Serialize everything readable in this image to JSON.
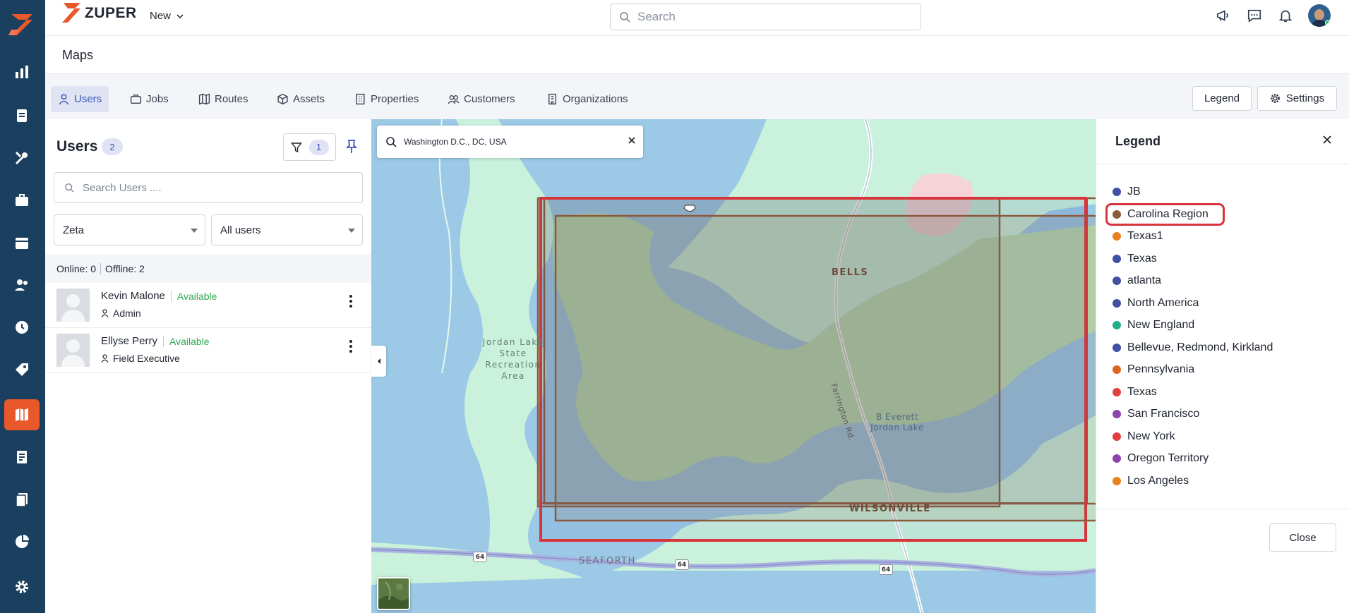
{
  "app": {
    "brand": "ZUPER",
    "new_menu": "New",
    "search_placeholder": "Search"
  },
  "page": {
    "title": "Maps"
  },
  "tabs": [
    {
      "label": "Users",
      "icon": "user-icon",
      "active": true
    },
    {
      "label": "Jobs",
      "icon": "briefcase-icon"
    },
    {
      "label": "Routes",
      "icon": "map-icon"
    },
    {
      "label": "Assets",
      "icon": "cube-icon"
    },
    {
      "label": "Properties",
      "icon": "building-icon"
    },
    {
      "label": "Customers",
      "icon": "people-icon"
    },
    {
      "label": "Organizations",
      "icon": "office-icon"
    }
  ],
  "toolbar": {
    "legend_label": "Legend",
    "settings_label": "Settings"
  },
  "users_panel": {
    "title": "Users",
    "count": "2",
    "filter_count": "1",
    "search_placeholder": "Search Users ....",
    "team_select": "Zeta",
    "users_select": "All users",
    "online": "Online: 0",
    "offline": "Offline: 2",
    "users": [
      {
        "name": "Kevin Malone",
        "status": "Available",
        "role": "Admin"
      },
      {
        "name": "Ellyse Perry",
        "status": "Available",
        "role": "Field Executive"
      }
    ]
  },
  "map": {
    "search_value": "Washington D.C., DC, USA",
    "labels": {
      "bells": "BELLS",
      "wilsonville": "WILSONVILLE",
      "seaforth": "SEAFORTH",
      "farrington": "Farrington Rd.",
      "lake_line1": "B Everett",
      "lake_line2": "Jordan Lake",
      "park_line1": "Jordan Lake",
      "park_line2": "State",
      "park_line3": "Recreation Area"
    },
    "highway": "64"
  },
  "legend": {
    "title": "Legend",
    "close_label": "Close",
    "items": [
      {
        "label": "JB",
        "color": "#3f51a3"
      },
      {
        "label": "Carolina Region",
        "color": "#8b5a3c",
        "highlighted": true
      },
      {
        "label": "Texas1",
        "color": "#e8821e"
      },
      {
        "label": "Texas",
        "color": "#3f51a3"
      },
      {
        "label": "atlanta",
        "color": "#3f51a3"
      },
      {
        "label": "North America",
        "color": "#3f51a3"
      },
      {
        "label": "New England",
        "color": "#1fae8e"
      },
      {
        "label": "Bellevue, Redmond, Kirkland",
        "color": "#3f51a3"
      },
      {
        "label": "Pennsylvania",
        "color": "#d9661c"
      },
      {
        "label": "Texas",
        "color": "#e0403e"
      },
      {
        "label": "San Francisco",
        "color": "#8e44ad"
      },
      {
        "label": "New York",
        "color": "#e0403e"
      },
      {
        "label": "Oregon Territory",
        "color": "#8e44ad"
      },
      {
        "label": "Los Angeles",
        "color": "#e8821e"
      }
    ]
  },
  "colors": {
    "rail": "#1b3f5e",
    "accent": "#e8582b",
    "active_tab": "#3a55b8",
    "available": "#2ea84f",
    "region_outline": "#d8343c"
  }
}
